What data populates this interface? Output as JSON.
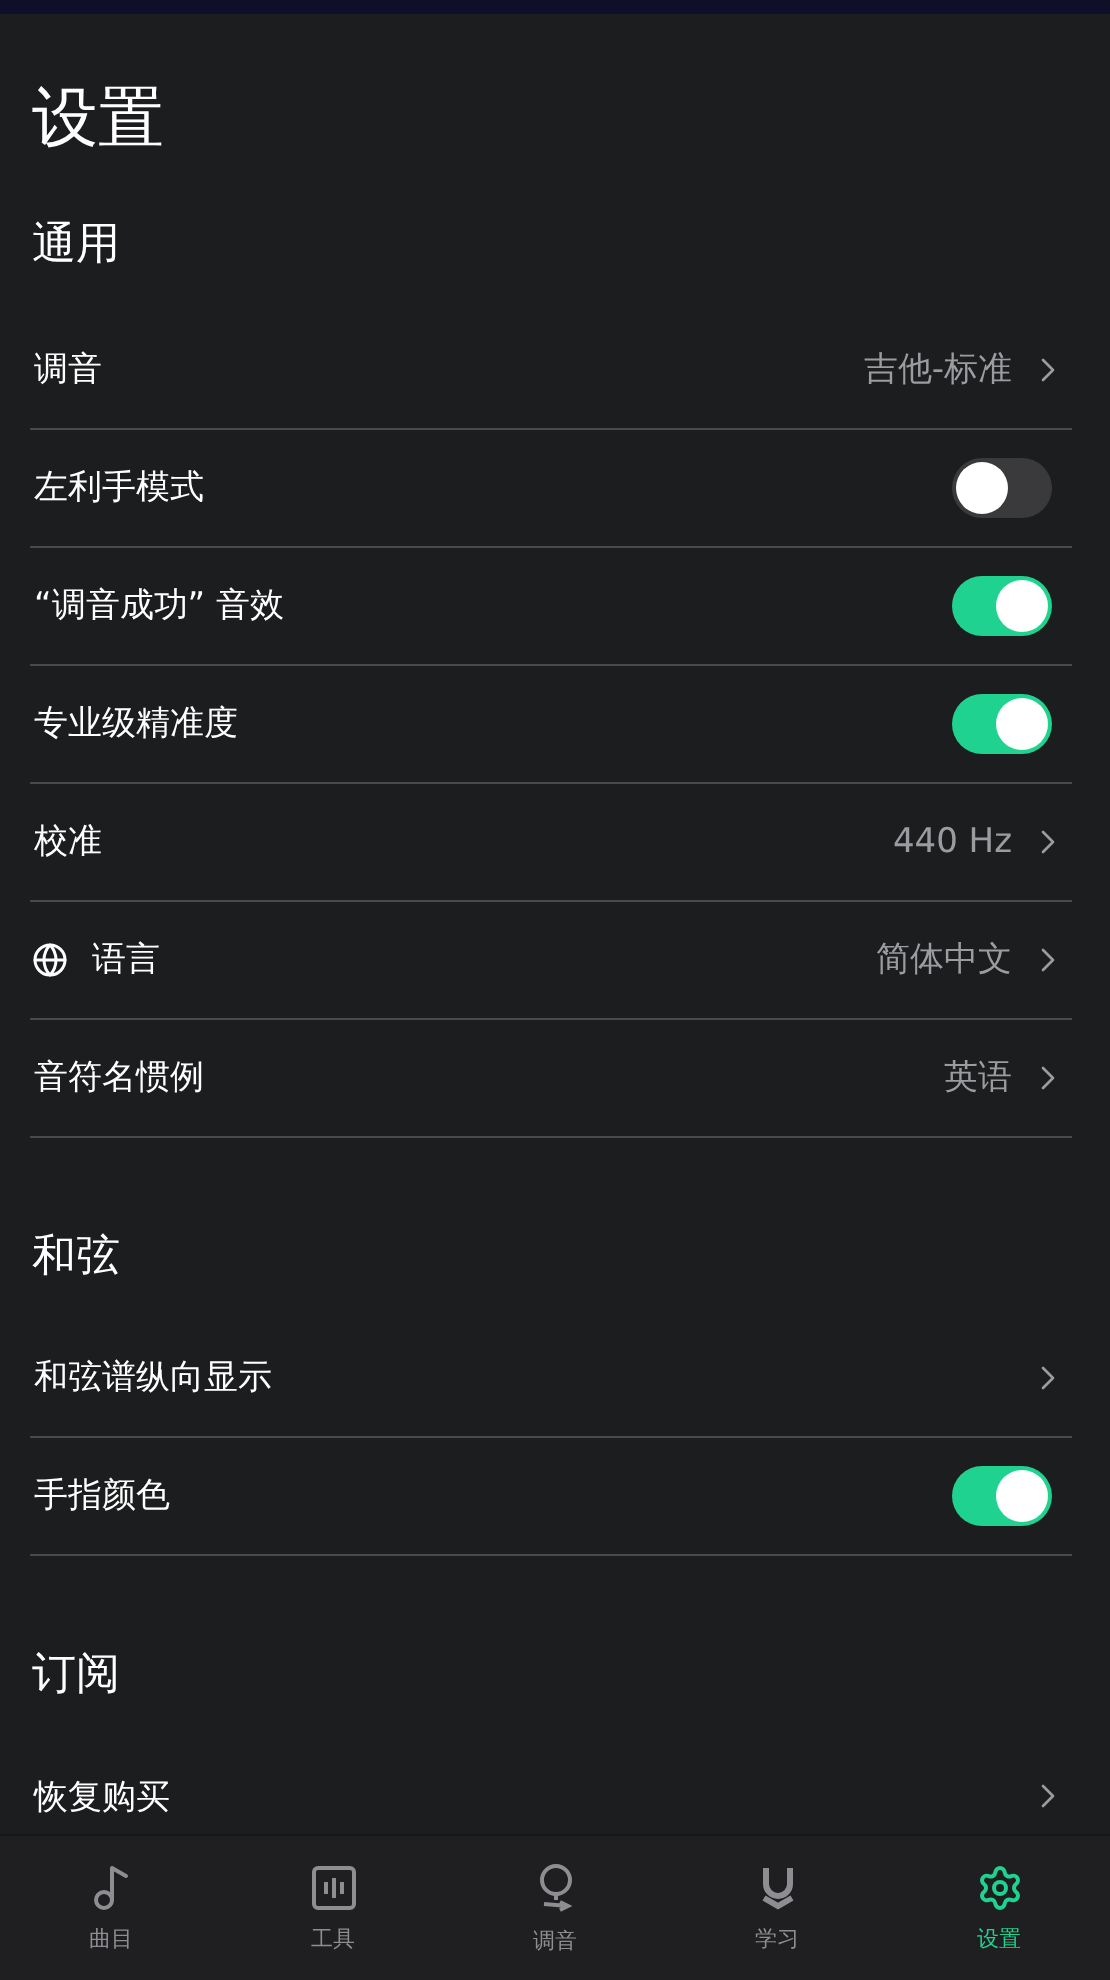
{
  "title": "设置",
  "sections": [
    {
      "header": "通用",
      "rows": [
        {
          "kind": "link",
          "label": "调音",
          "value": "吉他-标准"
        },
        {
          "kind": "toggle",
          "label": "左利手模式",
          "on": false
        },
        {
          "kind": "toggle",
          "label": "“调音成功” 音效",
          "on": true
        },
        {
          "kind": "toggle",
          "label": "专业级精准度",
          "on": true
        },
        {
          "kind": "link",
          "label": "校准",
          "value": "440 Hz"
        },
        {
          "kind": "language",
          "label": "语言",
          "value": "简体中文"
        },
        {
          "kind": "link",
          "label": "音符名惯例",
          "value": "英语"
        }
      ]
    },
    {
      "header": "和弦",
      "rows": [
        {
          "kind": "link",
          "label": "和弦谱纵向显示"
        },
        {
          "kind": "toggle",
          "label": "手指颜色",
          "on": true
        }
      ]
    },
    {
      "header": "订阅",
      "rows": [
        {
          "kind": "link",
          "label": "恢复购买"
        }
      ]
    }
  ],
  "tabs": [
    {
      "label": "曲目",
      "selected": false
    },
    {
      "label": "工具",
      "selected": false
    },
    {
      "label": "调音",
      "selected": false
    },
    {
      "label": "学习",
      "selected": false
    },
    {
      "label": "设置",
      "selected": true
    }
  ]
}
